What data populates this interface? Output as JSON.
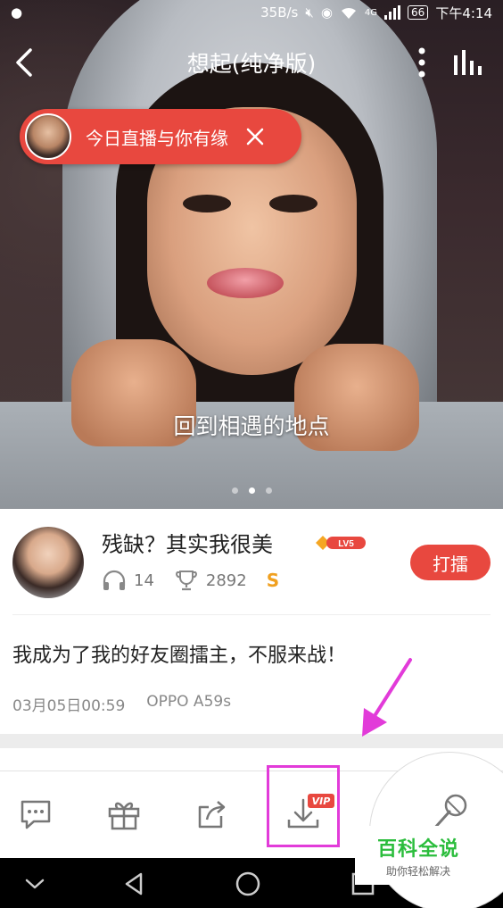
{
  "status_bar": {
    "speed": "35B/s",
    "network": "4G",
    "battery": "66",
    "time": "下午4:14"
  },
  "header": {
    "title": "想起(纯净版)"
  },
  "live_banner": {
    "text": "今日直播与你有缘"
  },
  "lyric": "回到相遇的地点",
  "carousel": {
    "count": 3,
    "active": 1
  },
  "user": {
    "name": "残缺？其实我很美",
    "level": "LV5",
    "listens": "14",
    "trophies": "2892",
    "coin": "S",
    "pk_label": "打擂"
  },
  "post": {
    "text": "我成为了我的好友圈擂主，不服来战！",
    "date": "03月05日00:59",
    "device": "OPPO A59s"
  },
  "toolbar": {
    "vip_badge": "VIP"
  },
  "watermark": {
    "title": "百科全说",
    "subtitle": "助你轻松解决"
  },
  "colors": {
    "accent": "#e8483f",
    "annotation": "#e23bd9",
    "watermark_green": "#2bbd3c"
  }
}
